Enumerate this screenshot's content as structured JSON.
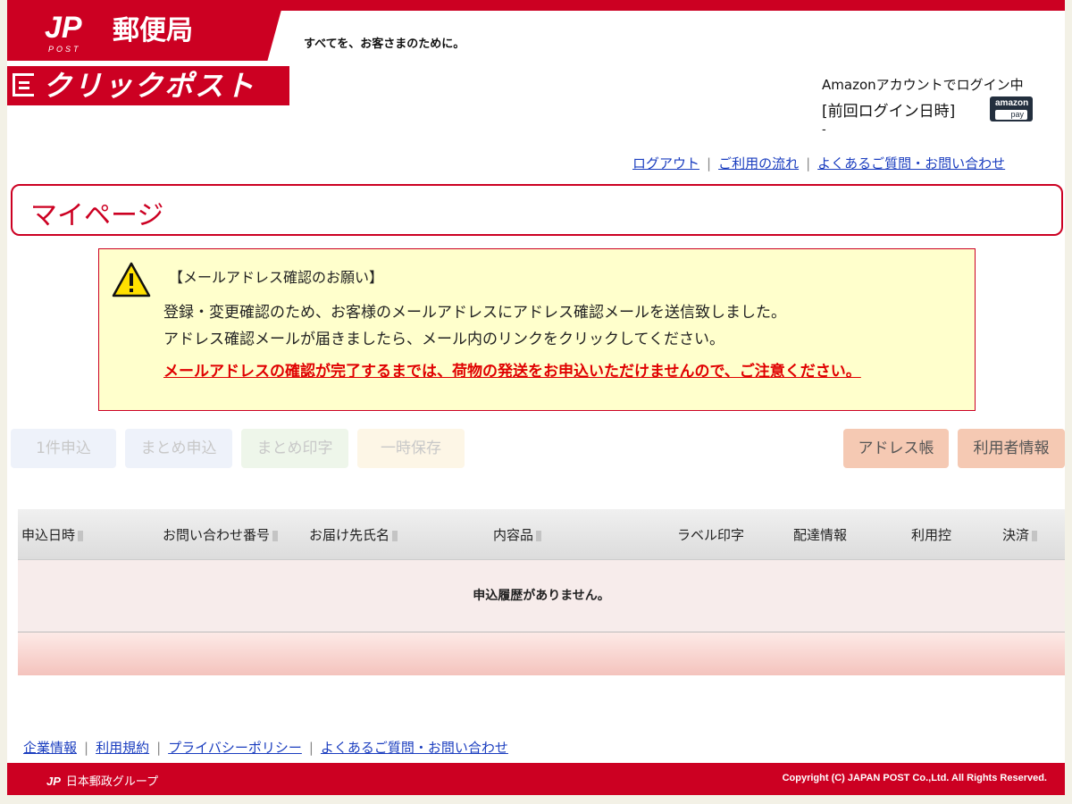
{
  "header": {
    "logo_mark": "JP",
    "logo_post": "POST",
    "logo_name": "郵便局",
    "tagline": "すべてを、お客さまのために。",
    "service_name": "クリックポスト"
  },
  "account": {
    "status": "Amazonアカウントでログイン中",
    "last_login_label": "[前回ログイン日時]",
    "last_login_value": "-",
    "amazon_pay_top": "amazon",
    "amazon_pay_bottom": "pay"
  },
  "top_links": [
    "ログアウト",
    "ご利用の流れ",
    "よくあるご質問・お問い合わせ"
  ],
  "page_title": "マイページ",
  "notice": {
    "title": "【メールアドレス確認のお願い】",
    "line1": "登録・変更確認のため、お客様のメールアドレスにアドレス確認メールを送信致しました。",
    "line2": "アドレス確認メールが届きましたら、メール内のリンクをクリックしてください。",
    "alert": "メールアドレスの確認が完了するまでは、荷物の発送をお申込いただけませんので、ご注意ください。"
  },
  "buttons": {
    "single": "1件申込",
    "bulk": "まとめ申込",
    "bulk_print": "まとめ印字",
    "temp_save": "一時保存",
    "address_book": "アドレス帳",
    "user_info": "利用者情報"
  },
  "table": {
    "headers": [
      "申込日時",
      "お問い合わせ番号",
      "お届け先氏名",
      "内容品",
      "ラベル印字",
      "配達情報",
      "利用控",
      "決済"
    ],
    "empty_message": "申込履歴がありません。"
  },
  "footer_links": [
    "企業情報",
    "利用規約",
    "プライバシーポリシー",
    "よくあるご質問・お問い合わせ"
  ],
  "footer": {
    "group_mark": "JP",
    "group_name": "日本郵政グループ",
    "copyright": "Copyright (C) JAPAN POST Co.,Ltd.  All Rights Reserved."
  }
}
